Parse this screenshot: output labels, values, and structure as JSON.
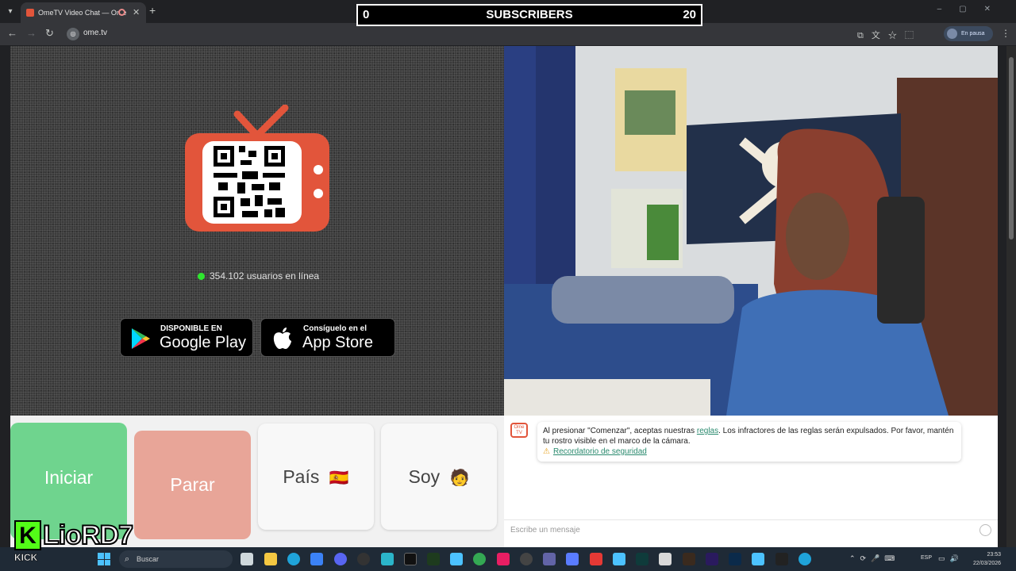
{
  "browser": {
    "tab_title": "OmeTV Video Chat — Ome",
    "url": "ome.tv",
    "paused_label": "En pausa",
    "site_icon": "ometv-icon"
  },
  "overlay": {
    "sub_left": "0",
    "sub_title": "SUBSCRIBERS",
    "sub_right": "20",
    "kick_letter": "K",
    "kick_name": "LioRD7",
    "kick_tag": "KICK"
  },
  "left_panel": {
    "online_text": "354.102 usuarios en línea",
    "google_play_small": "DISPONIBLE EN",
    "google_play_big": "Google Play",
    "app_store_small": "Consíguelo en el",
    "app_store_big": "App Store"
  },
  "controls": {
    "start": "Iniciar",
    "stop": "Parar",
    "country": "País",
    "country_flag": "🇪🇸",
    "gender": "Soy",
    "gender_emoji": "🧑"
  },
  "chat": {
    "logo_text": "Ome TV",
    "message_pre": "Al presionar \"Comenzar\", aceptas nuestras",
    "message_link": "reglas",
    "message_post": ". Los infractores de las reglas serán expulsados. Por favor, mantén tu rostro visible en el marco de la cámara.",
    "safety_link": "Recordatorio de seguridad",
    "input_placeholder": "Escribe un mensaje"
  },
  "taskbar": {
    "search_placeholder": "Buscar",
    "language": "ESP",
    "time": "23:53",
    "date": "22/03/2026"
  },
  "colors": {
    "accent_green": "#6fd48e",
    "stop_red": "#e8a598",
    "ome_orange": "#e2553b",
    "kick_green": "#53fc18"
  }
}
